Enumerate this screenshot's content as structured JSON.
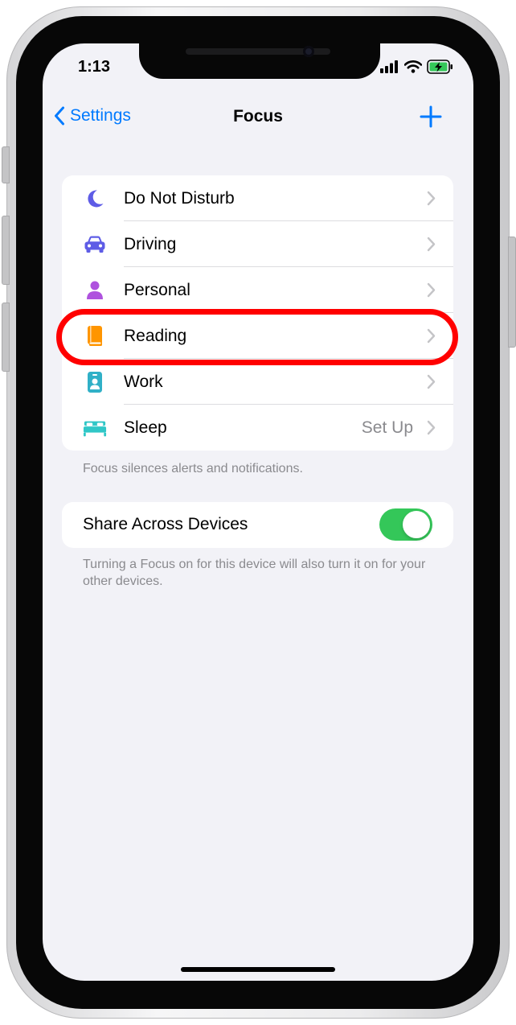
{
  "status_bar": {
    "time": "1:13"
  },
  "nav": {
    "back_label": "Settings",
    "title": "Focus"
  },
  "focus_modes": [
    {
      "label": "Do Not Disturb",
      "detail": "",
      "icon": "moon-icon",
      "color": "#5e5ce6"
    },
    {
      "label": "Driving",
      "detail": "",
      "icon": "car-icon",
      "color": "#5e5ce6"
    },
    {
      "label": "Personal",
      "detail": "",
      "icon": "person-icon",
      "color": "#af52de"
    },
    {
      "label": "Reading",
      "detail": "",
      "icon": "book-icon",
      "color": "#ff9500"
    },
    {
      "label": "Work",
      "detail": "",
      "icon": "id-badge-icon",
      "color": "#30b0c7"
    },
    {
      "label": "Sleep",
      "detail": "Set Up",
      "icon": "bed-icon",
      "color": "#30c7c7"
    }
  ],
  "focus_footer": "Focus silences alerts and notifications.",
  "share": {
    "label": "Share Across Devices",
    "enabled": true,
    "footer": "Turning a Focus on for this device will also turn it on for your other devices."
  },
  "colors": {
    "accent": "#007aff",
    "toggle_on": "#34c759",
    "annotation": "#ff0000",
    "background": "#f2f2f7"
  }
}
